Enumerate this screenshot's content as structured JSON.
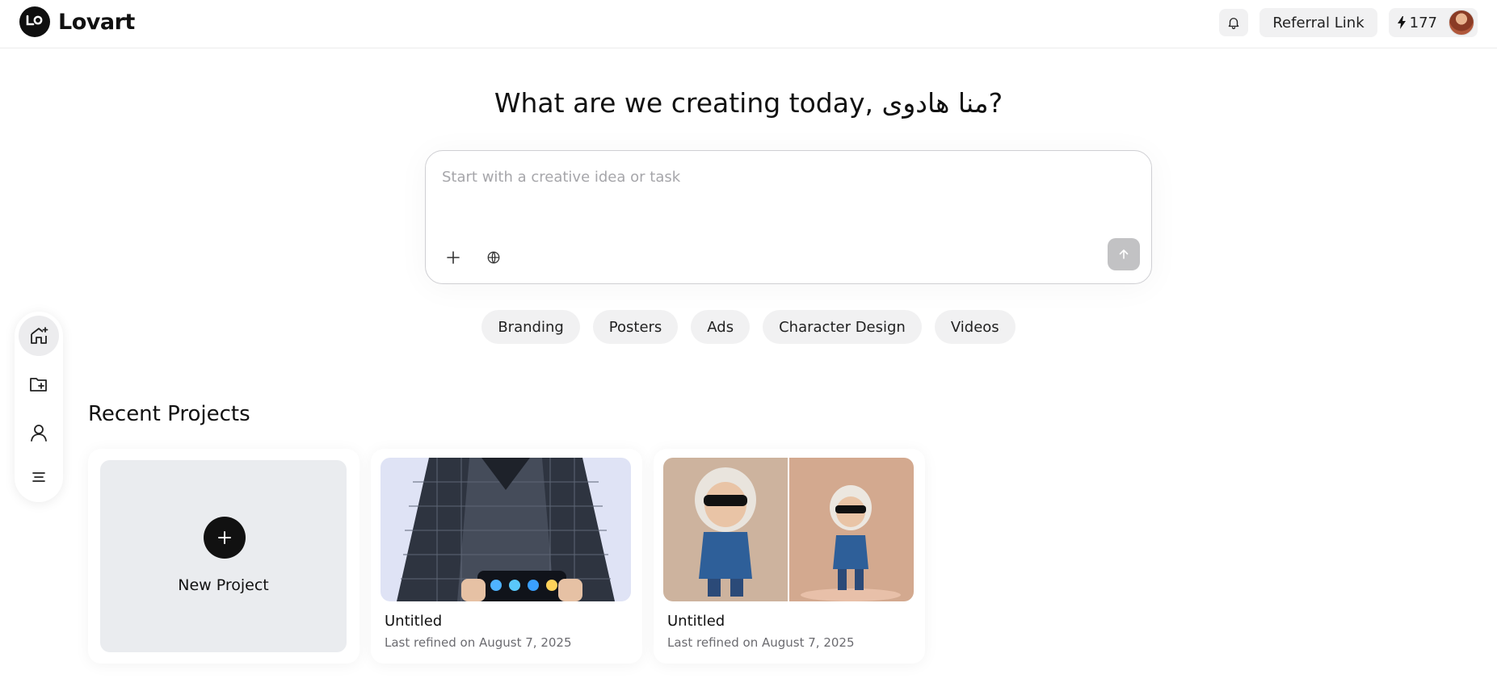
{
  "app": {
    "name": "Lovart"
  },
  "header": {
    "referral_label": "Referral Link",
    "credits": "177"
  },
  "hero": {
    "title": "What are we creating today,  منا هادوی?"
  },
  "prompt": {
    "placeholder": "Start with a creative idea or task",
    "value": ""
  },
  "chips": [
    "Branding",
    "Posters",
    "Ads",
    "Character Design",
    "Videos"
  ],
  "sidebar": {
    "items": [
      {
        "icon": "home-sparkle-icon",
        "active": true
      },
      {
        "icon": "folder-plus-icon",
        "active": false
      },
      {
        "icon": "user-icon",
        "active": false
      },
      {
        "icon": "menu-icon",
        "active": false
      }
    ]
  },
  "recent": {
    "title": "Recent Projects",
    "new_project_label": "New Project",
    "projects": [
      {
        "title": "Untitled",
        "subtitle": "Last refined on August 7, 2025"
      },
      {
        "title": "Untitled",
        "subtitle": "Last refined on August 7, 2025"
      }
    ]
  },
  "colors": {
    "accent": "#111111",
    "chip_bg": "#f1f1f2",
    "card_bg": "#eaecef"
  }
}
